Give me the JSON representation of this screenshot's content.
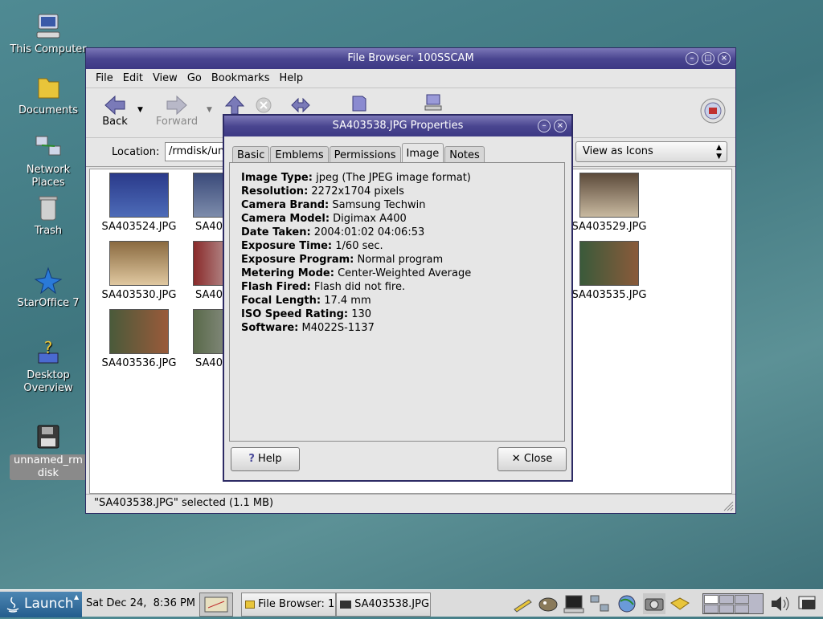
{
  "desktop": {
    "icons": [
      {
        "label": "This Computer",
        "icon": "computer-icon"
      },
      {
        "label": "Documents",
        "icon": "folder-icon"
      },
      {
        "label": "Network Places",
        "icon": "network-icon"
      },
      {
        "label": "Trash",
        "icon": "trash-icon"
      },
      {
        "label": "StarOffice 7",
        "icon": "staroffice-icon"
      },
      {
        "label": "Desktop Overview",
        "icon": "help-icon"
      },
      {
        "label": "unnamed_rmdisk",
        "icon": "floppy-icon"
      }
    ]
  },
  "file_browser": {
    "title": "File Browser: 100SSCAM",
    "menu": [
      "File",
      "Edit",
      "View",
      "Go",
      "Bookmarks",
      "Help"
    ],
    "toolbar": {
      "back": "Back",
      "forward": "Forward"
    },
    "location_label": "Location:",
    "location_value": "/rmdisk/un",
    "view_mode": "View as Icons",
    "thumbnails": [
      {
        "label": "SA403524.JPG",
        "colors": [
          "#2a3a8a",
          "#4d6bb8"
        ]
      },
      {
        "label": "SA40",
        "colors": [
          "#3a4a7a",
          "#7d8cab"
        ]
      },
      {
        "label": "SA403529.JPG",
        "colors": [
          "#5c4a3a",
          "#c8b9a0"
        ]
      },
      {
        "label": "SA403530.JPG",
        "colors": [
          "#8a6a40",
          "#e0c8a0"
        ]
      },
      {
        "label": "SA40",
        "colors": [
          "#8a2a2a",
          "#d0d0d0"
        ]
      },
      {
        "label": "SA403535.JPG",
        "colors": [
          "#3a5a3a",
          "#8a5a3a"
        ]
      },
      {
        "label": "SA403536.JPG",
        "colors": [
          "#4a5a3a",
          "#9a5a3a"
        ]
      },
      {
        "label": "SA40",
        "colors": [
          "#5a6a4a",
          "#a0a0a0"
        ]
      }
    ],
    "status": "\"SA403538.JPG\" selected (1.1 MB)"
  },
  "properties_dialog": {
    "title": "SA403538.JPG Properties",
    "tabs": [
      "Basic",
      "Emblems",
      "Permissions",
      "Image",
      "Notes"
    ],
    "active_tab": "Image",
    "properties": [
      {
        "key": "Image Type:",
        "value": "jpeg (The JPEG image format)"
      },
      {
        "key": "Resolution:",
        "value": "2272x1704 pixels"
      },
      {
        "key": "Camera Brand:",
        "value": "Samsung Techwin"
      },
      {
        "key": "Camera Model:",
        "value": "Digimax A400"
      },
      {
        "key": "Date Taken:",
        "value": "2004:01:02 04:06:53"
      },
      {
        "key": "Exposure Time:",
        "value": "1/60 sec."
      },
      {
        "key": "Exposure Program:",
        "value": "Normal program"
      },
      {
        "key": "Metering Mode:",
        "value": "Center-Weighted Average"
      },
      {
        "key": "Flash Fired:",
        "value": "Flash did not fire."
      },
      {
        "key": "Focal Length:",
        "value": "17.4 mm"
      },
      {
        "key": "ISO Speed Rating:",
        "value": "130"
      },
      {
        "key": "Software:",
        "value": "M4022S-1137"
      }
    ],
    "help_button": "Help",
    "close_button": "Close"
  },
  "taskbar": {
    "launch": "Launch",
    "clock": "Sat Dec 24,  8:36 PM",
    "tasks": [
      "File Browser: 1",
      "SA403538.JPG"
    ]
  },
  "colors": {
    "title_bar": "#4a4690",
    "desktop": "#4f8a93",
    "launch": "#245d8d"
  }
}
